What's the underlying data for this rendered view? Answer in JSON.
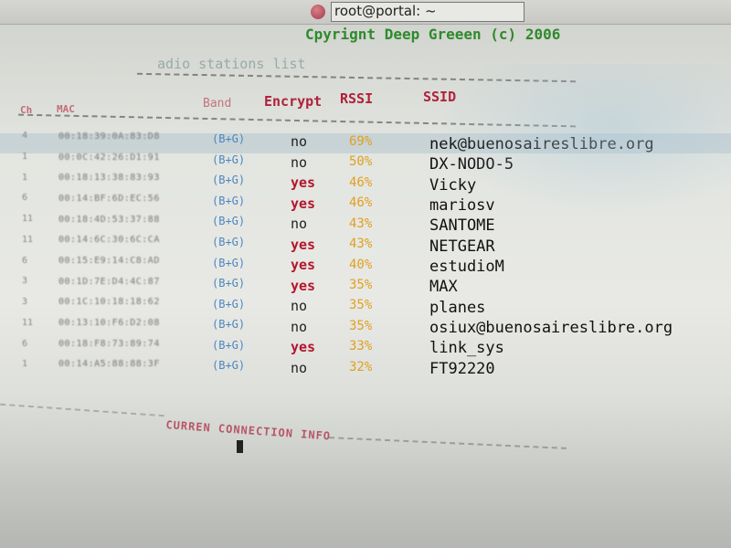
{
  "window": {
    "title": "root@portal: ~"
  },
  "header": {
    "copyright": "Cpyrignt Deep Greeen (c) 2006",
    "list_title": "adio stations list"
  },
  "table": {
    "columns": {
      "ch": "Ch",
      "mac": "MAC",
      "band": "Band",
      "encrypt": "Encrypt",
      "rssi": "RSSI",
      "ssid": "SSID"
    },
    "rows": [
      {
        "ch": "4",
        "mac": "00:18:39:0A:83:D8",
        "band": "(B+G)",
        "encrypt": "no",
        "rssi": "69%",
        "ssid": "nek@buenosaireslibre.org"
      },
      {
        "ch": "1",
        "mac": "00:0C:42:26:D1:91",
        "band": "(B+G)",
        "encrypt": "no",
        "rssi": "50%",
        "ssid": "DX-NODO-5"
      },
      {
        "ch": "1",
        "mac": "00:18:13:38:83:93",
        "band": "(B+G)",
        "encrypt": "yes",
        "rssi": "46%",
        "ssid": "Vicky"
      },
      {
        "ch": "6",
        "mac": "00:14:BF:6D:EC:56",
        "band": "(B+G)",
        "encrypt": "yes",
        "rssi": "46%",
        "ssid": "mariosv"
      },
      {
        "ch": "11",
        "mac": "00:18:4D:53:37:88",
        "band": "(B+G)",
        "encrypt": "no",
        "rssi": "43%",
        "ssid": "SANTOME"
      },
      {
        "ch": "11",
        "mac": "00:14:6C:30:6C:CA",
        "band": "(B+G)",
        "encrypt": "yes",
        "rssi": "43%",
        "ssid": "NETGEAR"
      },
      {
        "ch": "6",
        "mac": "00:15:E9:14:C8:AD",
        "band": "(B+G)",
        "encrypt": "yes",
        "rssi": "40%",
        "ssid": "estudioM"
      },
      {
        "ch": "3",
        "mac": "00:1D:7E:D4:4C:87",
        "band": "(B+G)",
        "encrypt": "yes",
        "rssi": "35%",
        "ssid": "MAX"
      },
      {
        "ch": "3",
        "mac": "00:1C:10:18:18:62",
        "band": "(B+G)",
        "encrypt": "no",
        "rssi": "35%",
        "ssid": "planes"
      },
      {
        "ch": "11",
        "mac": "00:13:10:F6:D2:08",
        "band": "(B+G)",
        "encrypt": "no",
        "rssi": "35%",
        "ssid": "osiux@buenosaireslibre.org"
      },
      {
        "ch": "6",
        "mac": "00:18:F8:73:89:74",
        "band": "(B+G)",
        "encrypt": "yes",
        "rssi": "33%",
        "ssid": "link_sys"
      },
      {
        "ch": "1",
        "mac": "00:14:A5:88:88:3F",
        "band": "(B+G)",
        "encrypt": "no",
        "rssi": "32%",
        "ssid": "FT92220"
      }
    ]
  },
  "footer": {
    "connection_title": "CURREN CONNECTION INFO"
  },
  "colors": {
    "header_red": "#b0203a",
    "copyright_green": "#2f8a2c",
    "band_blue": "#4a86c0",
    "rssi_amber": "#e0a020",
    "encrypt_yes_red": "#b4162c"
  }
}
